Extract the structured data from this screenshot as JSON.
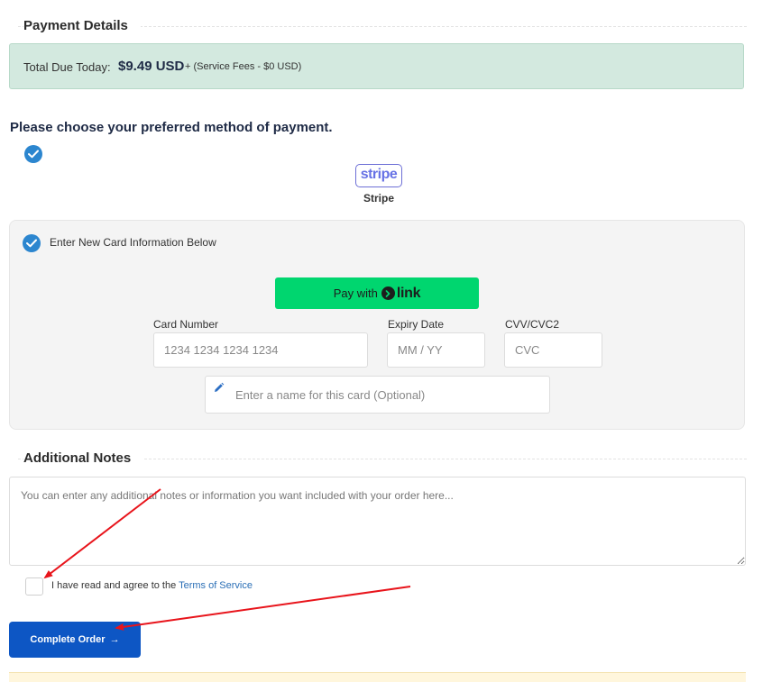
{
  "payment": {
    "title": "Payment Details",
    "total_label": "Total Due Today:",
    "total_amount": "$9.49 USD",
    "service_fees": "+ (Service Fees - $0 USD)"
  },
  "method": {
    "prompt": "Please choose your preferred method of payment.",
    "gateway_logo_text": "stripe",
    "gateway_name": "Stripe"
  },
  "card": {
    "new_card_label": "Enter New Card Information Below",
    "link_pay_text": "Pay with",
    "link_brand": "link",
    "card_number_label": "Card Number",
    "card_number_placeholder": "1234 1234 1234 1234",
    "expiry_label": "Expiry Date",
    "expiry_placeholder": "MM / YY",
    "cvv_label": "CVV/CVC2",
    "cvv_placeholder": "CVC",
    "name_placeholder": "Enter a name for this card (Optional)"
  },
  "notes": {
    "title": "Additional Notes",
    "placeholder": "You can enter any additional notes or information you want included with your order here..."
  },
  "tos": {
    "text": "I have read and agree to the",
    "link": "Terms of Service"
  },
  "order": {
    "button_label": "Complete Order",
    "button_arrow": "→"
  },
  "icons": {
    "check": "check-icon",
    "pencil": "pencil-icon",
    "arrow": "arrow-right-icon"
  },
  "colors": {
    "accent_blue": "#0d56c4",
    "check_blue": "#2c86cf",
    "link_green": "#00d66f",
    "total_box_bg": "#d3e9df",
    "annotation_red": "#e8141b"
  }
}
